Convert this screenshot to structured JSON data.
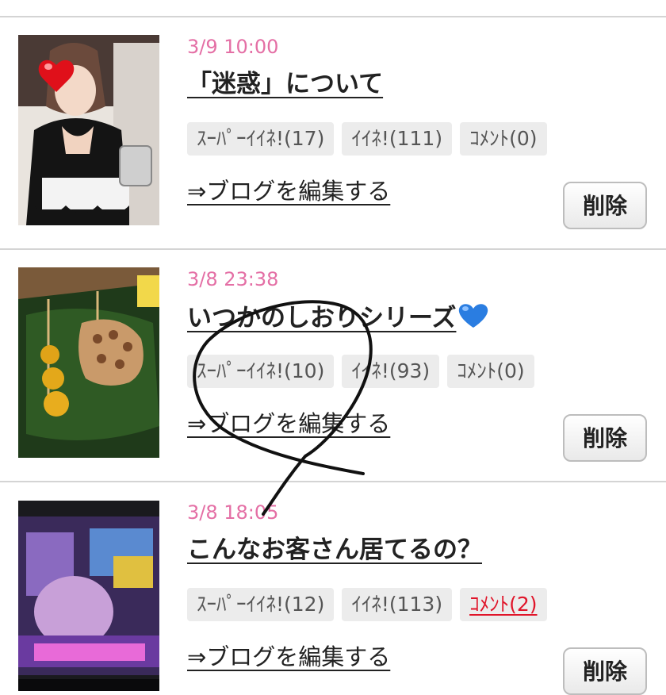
{
  "colors": {
    "date": "#e46fa5",
    "comment_active": "#e0152a",
    "tag_bg": "#ececec",
    "divider": "#d4d4d4"
  },
  "posts": [
    {
      "date": "3/9 10:00",
      "title": "「迷惑」について",
      "tags": [
        "ｽｰﾊﾟｰｲｲﾈ!(17)",
        "ｲｲﾈ!(111)",
        "ｺﾒﾝﾄ(0)"
      ],
      "edit_label": "⇒ブログを編集する",
      "delete_label": "削除",
      "thumb_icon": "heart-icon"
    },
    {
      "date": "3/8 23:38",
      "title": "いつかのしおりシリーズ",
      "title_emoji": "blue-heart-icon",
      "tags": [
        "ｽｰﾊﾟｰｲｲﾈ!(10)",
        "ｲｲﾈ!(93)",
        "ｺﾒﾝﾄ(0)"
      ],
      "edit_label": "⇒ブログを編集する",
      "delete_label": "削除"
    },
    {
      "date": "3/8 18:05",
      "title": "こんなお客さん居てるの？",
      "tags": [
        "ｽｰﾊﾟｰｲｲﾈ!(12)",
        "ｲｲﾈ!(113)",
        "ｺﾒﾝﾄ(2)"
      ],
      "edit_label": "⇒ブログを編集する",
      "delete_label": "削除"
    }
  ]
}
